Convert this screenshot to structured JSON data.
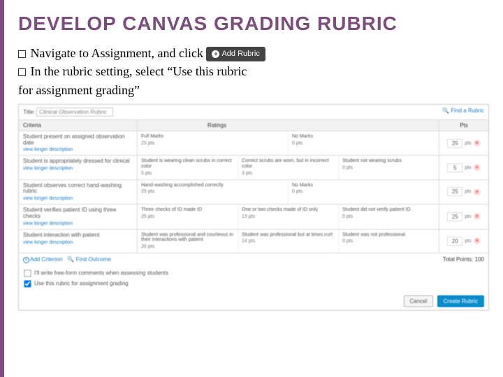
{
  "title": "DEVELOP CANVAS GRADING RUBRIC",
  "bullets": {
    "b1a": "Navigate to Assignment, and click",
    "b2a": "In the rubric setting, select “Use this rubric",
    "b2b": "for assignment grading”"
  },
  "add_rubric_btn": "Add Rubric",
  "rubric": {
    "title_label": "Title:",
    "title_value": "Clinical Observation Rubric",
    "find_link": "Find a Rubric",
    "head": {
      "criteria": "Criteria",
      "ratings": "Ratings",
      "pts": "Pts"
    },
    "rows": [
      {
        "crit": "Student present on assigned observation date",
        "ratings": [
          {
            "label": "Full Marks",
            "pts": "25 pts"
          },
          {
            "label": "No Marks",
            "pts": "0 pts"
          }
        ],
        "pts": "25"
      },
      {
        "crit": "Student is appropriately dressed for clinical",
        "ratings": [
          {
            "label": "Student is wearing clean scrubs in correct color",
            "pts": "5 pts"
          },
          {
            "label": "Correct scrubs are worn, but in incorrect color",
            "pts": "3 pts"
          },
          {
            "label": "Student not wearing scrubs",
            "pts": "0 pts"
          }
        ],
        "pts": "5"
      },
      {
        "crit": "Student observes correct hand-washing rubric",
        "ratings": [
          {
            "label": "Hand-washing accomplished correctly",
            "pts": "25 pts"
          },
          {
            "label": "No Marks",
            "pts": "0 pts"
          }
        ],
        "pts": "25"
      },
      {
        "crit": "Student verifies patient ID using three checks",
        "ratings": [
          {
            "label": "Three checks of ID made ID",
            "pts": "25 pts"
          },
          {
            "label": "One or two checks made of ID only",
            "pts": "13 pts"
          },
          {
            "label": "Student did not verify patient ID",
            "pts": "0 pts"
          }
        ],
        "pts": "25"
      },
      {
        "crit": "Student interaction with patient",
        "ratings": [
          {
            "label": "Student was professional and courteous in their interactions with patient",
            "pts": "20 pts"
          },
          {
            "label": "Student was professional but at times curt",
            "pts": "14 pts"
          },
          {
            "label": "Student was not professional",
            "pts": "0 pts"
          }
        ],
        "pts": "20"
      }
    ],
    "add_criterion": "Add Criterion",
    "find_outcome": "Find Outcome",
    "total_label": "Total Points:",
    "total_value": "100",
    "view_long": "view longer description",
    "checks": {
      "c1": "I'll write free-form comments when assessing students",
      "c2": "Use this rubric for assignment grading"
    },
    "cancel": "Cancel",
    "create": "Create Rubric"
  }
}
